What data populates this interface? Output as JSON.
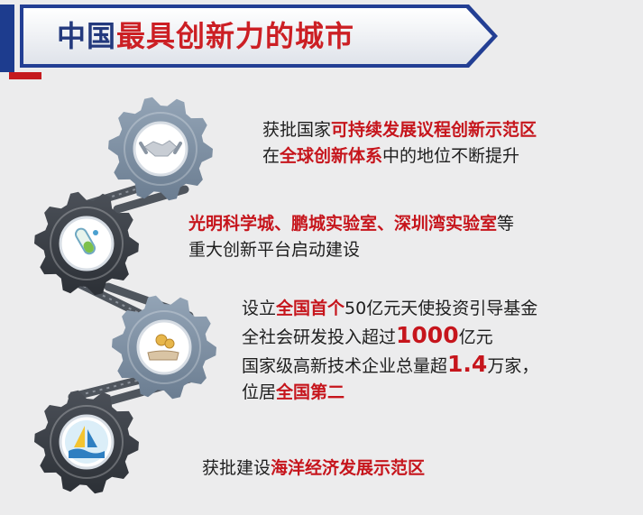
{
  "title": {
    "part1": "中国",
    "part2": "最具创新力的城市"
  },
  "colors": {
    "title_blue": "#23397d",
    "accent_red": "#cc1f24",
    "gear_light": "#8192a4",
    "gear_dark": "#3a3e45",
    "chain": "#545a62"
  },
  "icons": [
    "handshake-icon",
    "test-tube-icon",
    "hand-coin-icon",
    "sailboat-icon"
  ],
  "block1": {
    "l1a": "获批国家",
    "l1b": "可持续发展议程创新示范区",
    "l2a": "在",
    "l2b": "全球创新体系",
    "l2c": "中的地位不断提升"
  },
  "block2": {
    "l1a": "光明科学城、鹏城实验室、深圳湾实验室",
    "l1b": "等",
    "l2": "重大创新平台启动建设"
  },
  "block3": {
    "l1a": "设立",
    "l1b": "全国首个",
    "l1c": "50亿元天使投资引导基金",
    "l2a": "全社会研发投入超过",
    "l2b": "1000",
    "l2c": "亿元",
    "l3a": "国家级高新技术企业总量超",
    "l3b": "1.4",
    "l3c": "万家，",
    "l4a": "位居",
    "l4b": "全国第二"
  },
  "block4": {
    "l1a": "获批建设",
    "l1b": "海洋经济发展示范区"
  }
}
